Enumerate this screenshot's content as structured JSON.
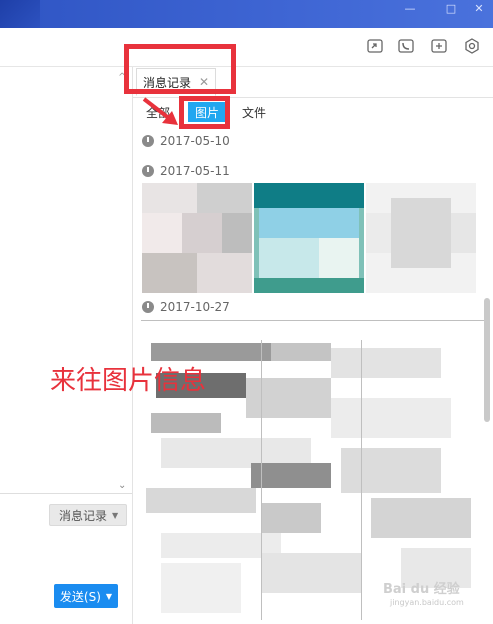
{
  "window": {
    "controls": [
      "?",
      "—",
      "□",
      "✕"
    ]
  },
  "toolbar": {
    "icons": [
      "screen-share-icon",
      "phone-icon",
      "add-member-icon",
      "settings-icon"
    ]
  },
  "right_panel": {
    "tab": {
      "label": "消息记录",
      "close": "✕"
    },
    "filters": {
      "all": "全部",
      "images": "图片",
      "files": "文件"
    },
    "dates": [
      "2017-05-10",
      "2017-05-11",
      "2017-10-27"
    ]
  },
  "left_panel": {
    "message_record_button": "消息记录",
    "send_button": "发送(S)",
    "dropdown_caret": "▼"
  },
  "annotation": {
    "caption": "来往图片信息"
  },
  "watermark": {
    "brand": "Bai du 经验",
    "url": "jingyan.baidu.com"
  }
}
